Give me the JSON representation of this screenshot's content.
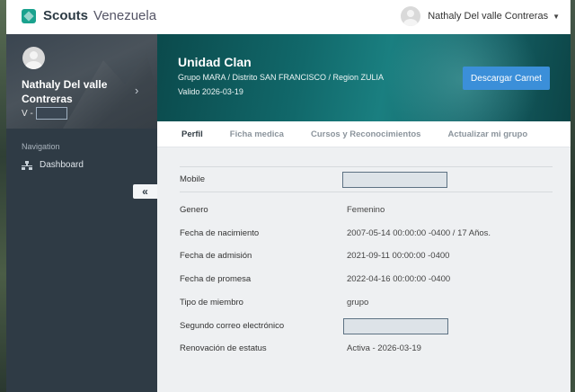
{
  "brand": {
    "name": "Scouts",
    "subtitle": "Venezuela"
  },
  "user": {
    "name": "Nathaly Del valle Contreras"
  },
  "sidebar": {
    "profile": {
      "name": "Nathaly Del valle Contreras",
      "id_prefix": "V -"
    },
    "nav_heading": "Navigation",
    "items": [
      {
        "label": "Dashboard",
        "icon": "sitemap-icon"
      }
    ]
  },
  "banner": {
    "title": "Unidad Clan",
    "subtitle": "Grupo MARA / Distrito SAN FRANCISCO / Region ZULIA",
    "valid": "Valido 2026-03-19",
    "button_label": "Descargar Carnet"
  },
  "tabs": [
    {
      "label": "Perfil",
      "active": true
    },
    {
      "label": "Ficha medica",
      "active": false
    },
    {
      "label": "Cursos y Reconocimientos",
      "active": false
    },
    {
      "label": "Actualizar mi grupo",
      "active": false
    }
  ],
  "profile_fields": [
    {
      "label": "Mobile",
      "value": ""
    },
    {
      "label": "Genero",
      "value": "Femenino"
    },
    {
      "label": "Fecha de nacimiento",
      "value": "2007-05-14 00:00:00 -0400 / 17 Años."
    },
    {
      "label": "Fecha de admisión",
      "value": "2021-09-11 00:00:00 -0400"
    },
    {
      "label": "Fecha de promesa",
      "value": "2022-04-16 00:00:00 -0400"
    },
    {
      "label": "Tipo de miembro",
      "value": "grupo"
    },
    {
      "label": "Segundo correo electrónico",
      "value": ""
    },
    {
      "label": "Renovación de estatus",
      "value": "Activa - 2026-03-19"
    }
  ],
  "colors": {
    "accent": "#3b8fd9",
    "brand": "#1aa28e",
    "sidebar": "#2f3b45"
  }
}
